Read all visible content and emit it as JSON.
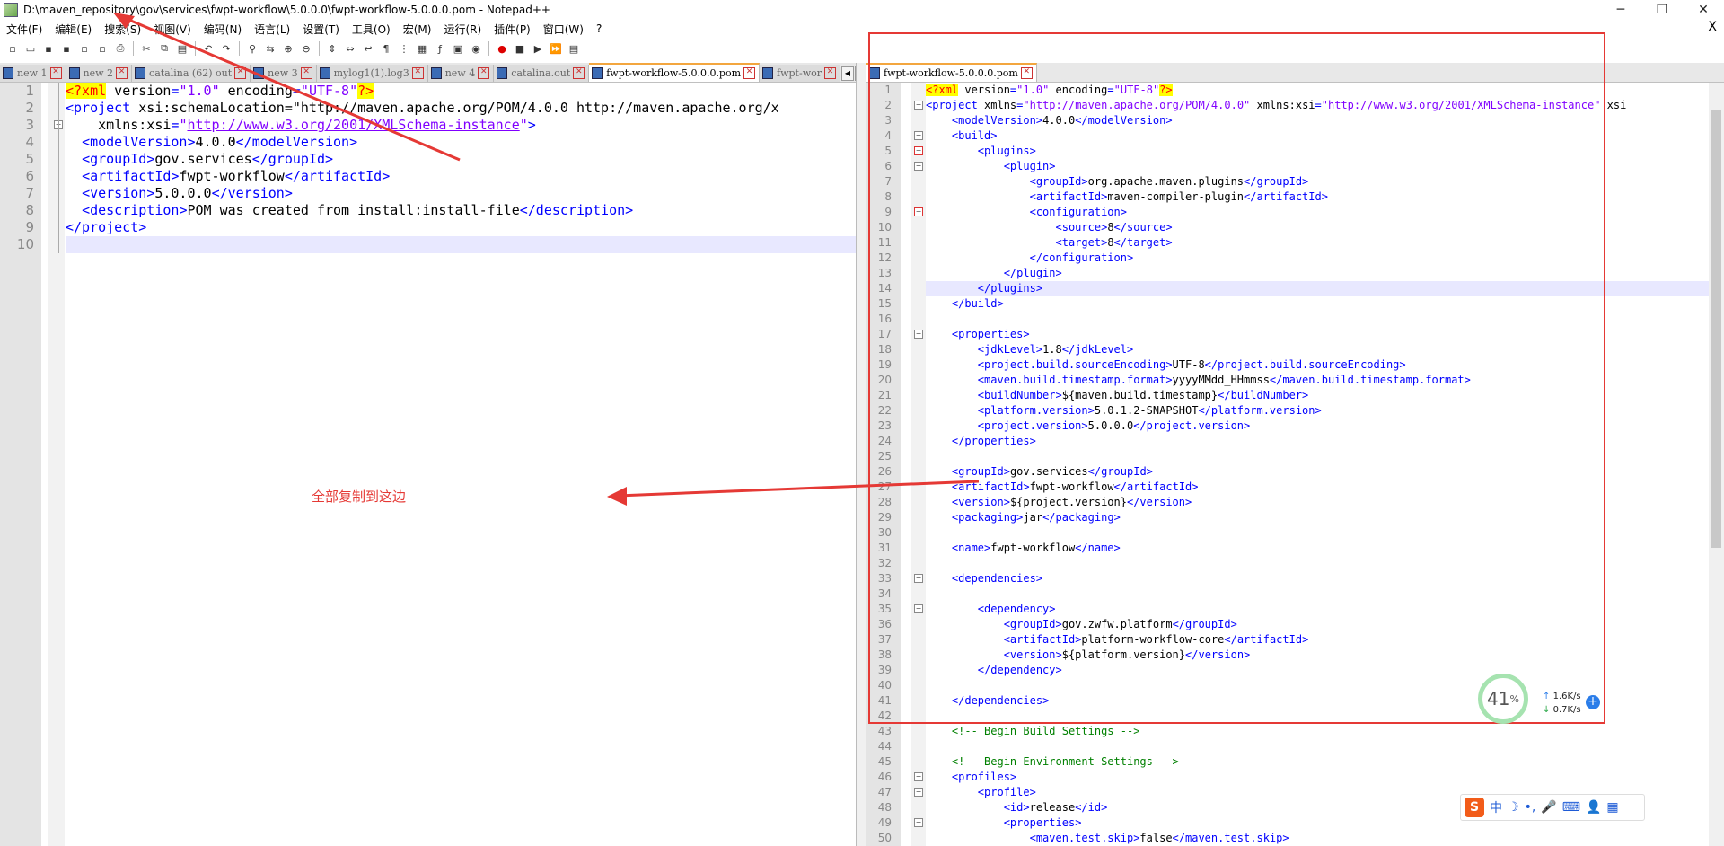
{
  "window": {
    "title": "D:\\maven_repository\\gov\\services\\fwpt-workflow\\5.0.0.0\\fwpt-workflow-5.0.0.0.pom - Notepad++",
    "min_glyph": "─",
    "max_glyph": "❐",
    "close_glyph": "✕"
  },
  "menu": {
    "items": [
      "文件(F)",
      "编辑(E)",
      "搜索(S)",
      "视图(V)",
      "编码(N)",
      "语言(L)",
      "设置(T)",
      "工具(O)",
      "宏(M)",
      "运行(R)",
      "插件(P)",
      "窗口(W)",
      "?"
    ],
    "close_glyph": "X"
  },
  "left_tabs": [
    {
      "label": "new 1",
      "active": false
    },
    {
      "label": "new 2",
      "active": false
    },
    {
      "label": "catalina (62) out",
      "active": false
    },
    {
      "label": "new 3",
      "active": false
    },
    {
      "label": "mylog1(1).log3",
      "active": false
    },
    {
      "label": "new 4",
      "active": false
    },
    {
      "label": "catalina.out",
      "active": false
    },
    {
      "label": "fwpt-workflow-5.0.0.0.pom",
      "active": true
    },
    {
      "label": "fwpt-wor",
      "active": false
    }
  ],
  "right_tabs": [
    {
      "label": "fwpt-workflow-5.0.0.0.pom",
      "active": true
    }
  ],
  "tab_close_glyph": "✕",
  "left_editor": {
    "current_line": 10,
    "lines": [
      "<?xml version=\"1.0\" encoding=\"UTF-8\"?>",
      "<project xsi:schemaLocation=\"http://maven.apache.org/POM/4.0.0 http://maven.apache.org/x",
      "    xmlns:xsi=\"http://www.w3.org/2001/XMLSchema-instance\">",
      "  <modelVersion>4.0.0</modelVersion>",
      "  <groupId>gov.services</groupId>",
      "  <artifactId>fwpt-workflow</artifactId>",
      "  <version>5.0.0.0</version>",
      "  <description>POM was created from install:install-file</description>",
      "</project>",
      ""
    ]
  },
  "right_editor": {
    "current_line": 14,
    "lines": [
      "<?xml version=\"1.0\" encoding=\"UTF-8\"?>",
      "<project xmlns=\"http://maven.apache.org/POM/4.0.0\" xmlns:xsi=\"http://www.w3.org/2001/XMLSchema-instance\" xsi",
      "    <modelVersion>4.0.0</modelVersion>",
      "    <build>",
      "        <plugins>",
      "            <plugin>",
      "                <groupId>org.apache.maven.plugins</groupId>",
      "                <artifactId>maven-compiler-plugin</artifactId>",
      "                <configuration>",
      "                    <source>8</source>",
      "                    <target>8</target>",
      "                </configuration>",
      "            </plugin>",
      "        </plugins>",
      "    </build>",
      "",
      "    <properties>",
      "        <jdkLevel>1.8</jdkLevel>",
      "        <project.build.sourceEncoding>UTF-8</project.build.sourceEncoding>",
      "        <maven.build.timestamp.format>yyyyMMdd_HHmmss</maven.build.timestamp.format>",
      "        <buildNumber>${maven.build.timestamp}</buildNumber>",
      "        <platform.version>5.0.1.2-SNAPSHOT</platform.version>",
      "        <project.version>5.0.0.0</project.version>",
      "    </properties>",
      "",
      "    <groupId>gov.services</groupId>",
      "    <artifactId>fwpt-workflow</artifactId>",
      "    <version>${project.version}</version>",
      "    <packaging>jar</packaging>",
      "",
      "    <name>fwpt-workflow</name>",
      "",
      "    <dependencies>",
      "",
      "        <dependency>",
      "            <groupId>gov.zwfw.platform</groupId>",
      "            <artifactId>platform-workflow-core</artifactId>",
      "            <version>${platform.version}</version>",
      "        </dependency>",
      "",
      "    </dependencies>",
      "",
      "    <!-- Begin Build Settings -->",
      "",
      "    <!-- Begin Environment Settings -->",
      "    <profiles>",
      "        <profile>",
      "            <id>release</id>",
      "            <properties>",
      "                <maven.test.skip>false</maven.test.skip>"
    ]
  },
  "annotation": {
    "text": "全部复制到这边",
    "color": "#e53935"
  },
  "network_widget": {
    "percent": "41",
    "percent_unit": "%",
    "upload": "1.6K/s",
    "download": "0.7K/s",
    "up_arrow": "↑",
    "down_arrow": "↓",
    "add_glyph": "+"
  },
  "ime_bar": {
    "logo": "S",
    "mode": "中",
    "moon": "☽",
    "punct": "•,",
    "mic": "🎤",
    "keyboard": "⌨",
    "user": "👤",
    "grid": "▦"
  },
  "colors": {
    "tag": "#0000ff",
    "attribute": "#ff0000",
    "value": "#8000ff",
    "comment": "#008000",
    "highlight_box": "#e53935",
    "current_line": "#e8e8ff"
  },
  "toolbar_icons": [
    "new-file-icon",
    "open-file-icon",
    "save-icon",
    "save-all-icon",
    "close-icon",
    "close-all-icon",
    "print-icon",
    "cut-icon",
    "copy-icon",
    "paste-icon",
    "undo-icon",
    "redo-icon",
    "find-icon",
    "replace-icon",
    "zoom-in-icon",
    "zoom-out-icon",
    "sync-v-icon",
    "sync-h-icon",
    "wrap-icon",
    "all-chars-icon",
    "indent-guide-icon",
    "doc-map-icon",
    "function-list-icon",
    "folder-workspace-icon",
    "monitor-icon",
    "record-macro-icon",
    "stop-macro-icon",
    "play-macro-icon",
    "run-macro-multiple-icon",
    "save-macro-icon"
  ],
  "toolbar_glyphs": [
    "▫",
    "▭",
    "▪",
    "▪",
    "▫",
    "▫",
    "⎙",
    "✂",
    "⧉",
    "▤",
    "↶",
    "↷",
    "⚲",
    "⇆",
    "⊕",
    "⊖",
    "⇕",
    "⇔",
    "↩",
    "¶",
    "⋮",
    "▦",
    "ƒ",
    "▣",
    "◉",
    "●",
    "■",
    "▶",
    "⏩",
    "▤"
  ]
}
